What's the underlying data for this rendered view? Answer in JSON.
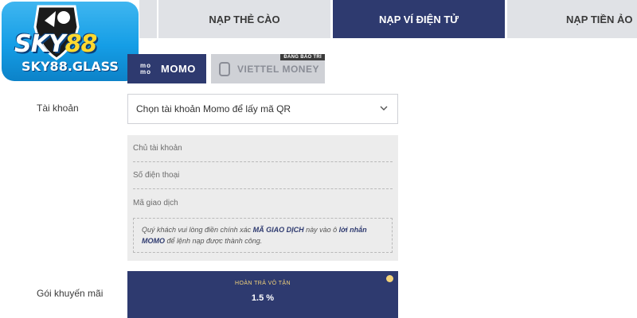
{
  "logo": {
    "brand_text": "SKY",
    "brand_number": "88",
    "domain": "SKY88.GLASS"
  },
  "top_tabs": [
    {
      "label": "",
      "active": false
    },
    {
      "label": "NẠP THẺ CÀO",
      "active": false
    },
    {
      "label": "NẠP VÍ ĐIỆN TỬ",
      "active": true
    },
    {
      "label": "NẠP TIỀN ẢO",
      "active": false
    }
  ],
  "wallets": {
    "momo": {
      "icon_text": "mo mo",
      "label": "MOMO",
      "selected": true
    },
    "viettel": {
      "label": "VIETTEL MONEY",
      "badge": "ĐANG BẢO TRÌ",
      "icon": "phone-icon"
    }
  },
  "account": {
    "label": "Tài khoản",
    "select_value": "Chọn tài khoản Momo để lấy mã QR"
  },
  "info_fields": {
    "owner": "Chủ tài khoản",
    "phone": "Số điện thoại",
    "code": "Mã giao dịch"
  },
  "note": {
    "part1": "Quý khách vui lòng điền chính xác ",
    "code": "MÃ GIAO DỊCH",
    "part2": " này vào ô ",
    "message": "lời nhắn",
    "momo": "MOMO",
    "part3": " để lệnh nạp được thành công."
  },
  "promo": {
    "label": "Gói khuyến mãi",
    "title": "HOÀN TRẢ VÔ TẬN",
    "value": "1.5 %"
  },
  "colors": {
    "navy": "#2e3a6f",
    "tab_inactive": "#e0e2e6",
    "gold": "#f3d37a",
    "logo_blue": "#159ee6"
  }
}
